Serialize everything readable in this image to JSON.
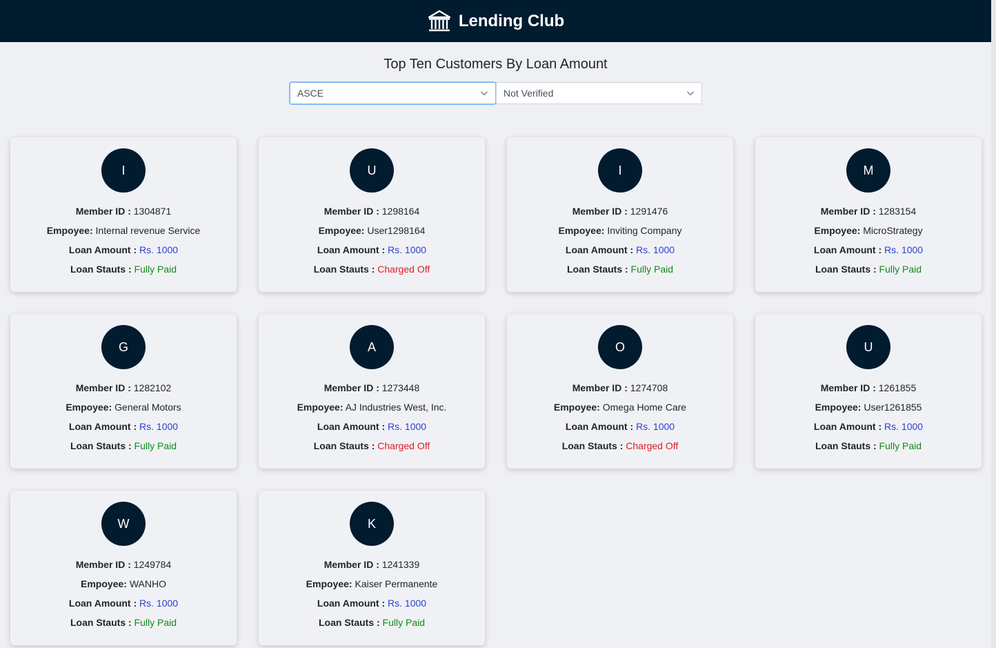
{
  "app": {
    "title": "Lending Club",
    "logo_icon": "bank-icon"
  },
  "page": {
    "heading": "Top Ten Customers By Loan Amount"
  },
  "filters": {
    "sort_order": {
      "selected": "ASCE"
    },
    "verification": {
      "selected": "Not Verified"
    }
  },
  "labels": {
    "member_id": "Member ID :",
    "employee": "Empoyee:",
    "loan_amount": "Loan Amount :",
    "loan_status": "Loan Stauts :"
  },
  "colors": {
    "navbar": "#011b2f",
    "amount": "#2b3fd1",
    "fully_paid": "#118a1f",
    "charged_off": "#e01c24"
  },
  "customers": [
    {
      "initial": "I",
      "member_id": "1304871",
      "employee": "Internal revenue Service",
      "loan_amount": "Rs. 1000",
      "loan_status": "Fully Paid"
    },
    {
      "initial": "U",
      "member_id": "1298164",
      "employee": "User1298164",
      "loan_amount": "Rs. 1000",
      "loan_status": "Charged Off"
    },
    {
      "initial": "I",
      "member_id": "1291476",
      "employee": "Inviting Company",
      "loan_amount": "Rs. 1000",
      "loan_status": "Fully Paid"
    },
    {
      "initial": "M",
      "member_id": "1283154",
      "employee": "MicroStrategy",
      "loan_amount": "Rs. 1000",
      "loan_status": "Fully Paid"
    },
    {
      "initial": "G",
      "member_id": "1282102",
      "employee": "General Motors",
      "loan_amount": "Rs. 1000",
      "loan_status": "Fully Paid"
    },
    {
      "initial": "A",
      "member_id": "1273448",
      "employee": "AJ Industries West, Inc.",
      "loan_amount": "Rs. 1000",
      "loan_status": "Charged Off"
    },
    {
      "initial": "O",
      "member_id": "1274708",
      "employee": "Omega Home Care",
      "loan_amount": "Rs. 1000",
      "loan_status": "Charged Off"
    },
    {
      "initial": "U",
      "member_id": "1261855",
      "employee": "User1261855",
      "loan_amount": "Rs. 1000",
      "loan_status": "Fully Paid"
    },
    {
      "initial": "W",
      "member_id": "1249784",
      "employee": "WANHO",
      "loan_amount": "Rs. 1000",
      "loan_status": "Fully Paid"
    },
    {
      "initial": "K",
      "member_id": "1241339",
      "employee": "Kaiser Permanente",
      "loan_amount": "Rs. 1000",
      "loan_status": "Fully Paid"
    }
  ]
}
